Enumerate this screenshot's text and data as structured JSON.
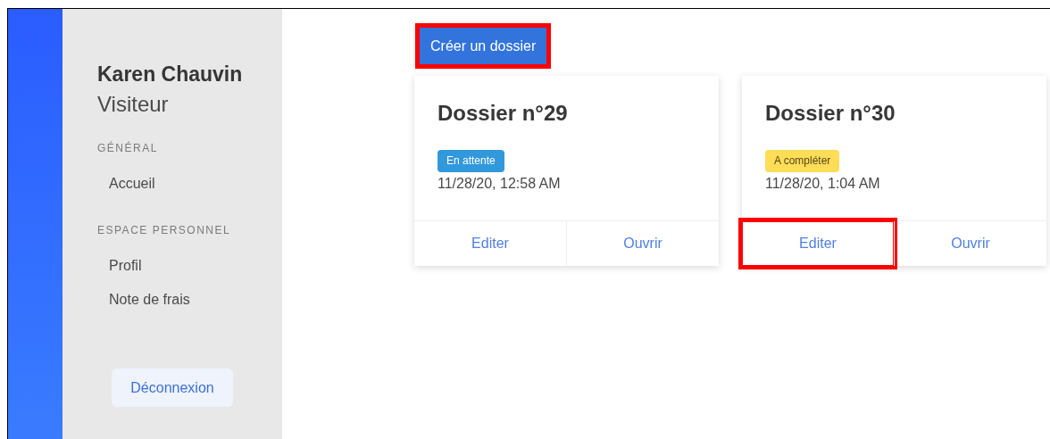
{
  "sidebar": {
    "user_name": "Karen Chauvin",
    "role": "Visiteur",
    "sections": [
      {
        "heading": "GÉNÉRAL",
        "items": [
          {
            "label": "Accueil"
          }
        ]
      },
      {
        "heading": "ESPACE PERSONNEL",
        "items": [
          {
            "label": "Profil"
          },
          {
            "label": "Note de frais"
          }
        ]
      }
    ],
    "logout_button": "Déconnexion"
  },
  "create_button": {
    "label": "Créer un dossier",
    "highlighted": true
  },
  "cards": [
    {
      "title": "Dossier n°29",
      "status": {
        "label": "En attente",
        "color": "#3298dc"
      },
      "date": "11/28/20, 12:58 AM",
      "actions": [
        {
          "label": "Editer",
          "highlighted": false
        },
        {
          "label": "Ouvrir",
          "highlighted": false
        }
      ]
    },
    {
      "title": "Dossier n°30",
      "status": {
        "label": "A compléter",
        "color": "#ffdd57"
      },
      "date": "11/28/20, 1:04 AM",
      "actions": [
        {
          "label": "Editer",
          "highlighted": true
        },
        {
          "label": "Ouvrir",
          "highlighted": false
        }
      ]
    }
  ]
}
